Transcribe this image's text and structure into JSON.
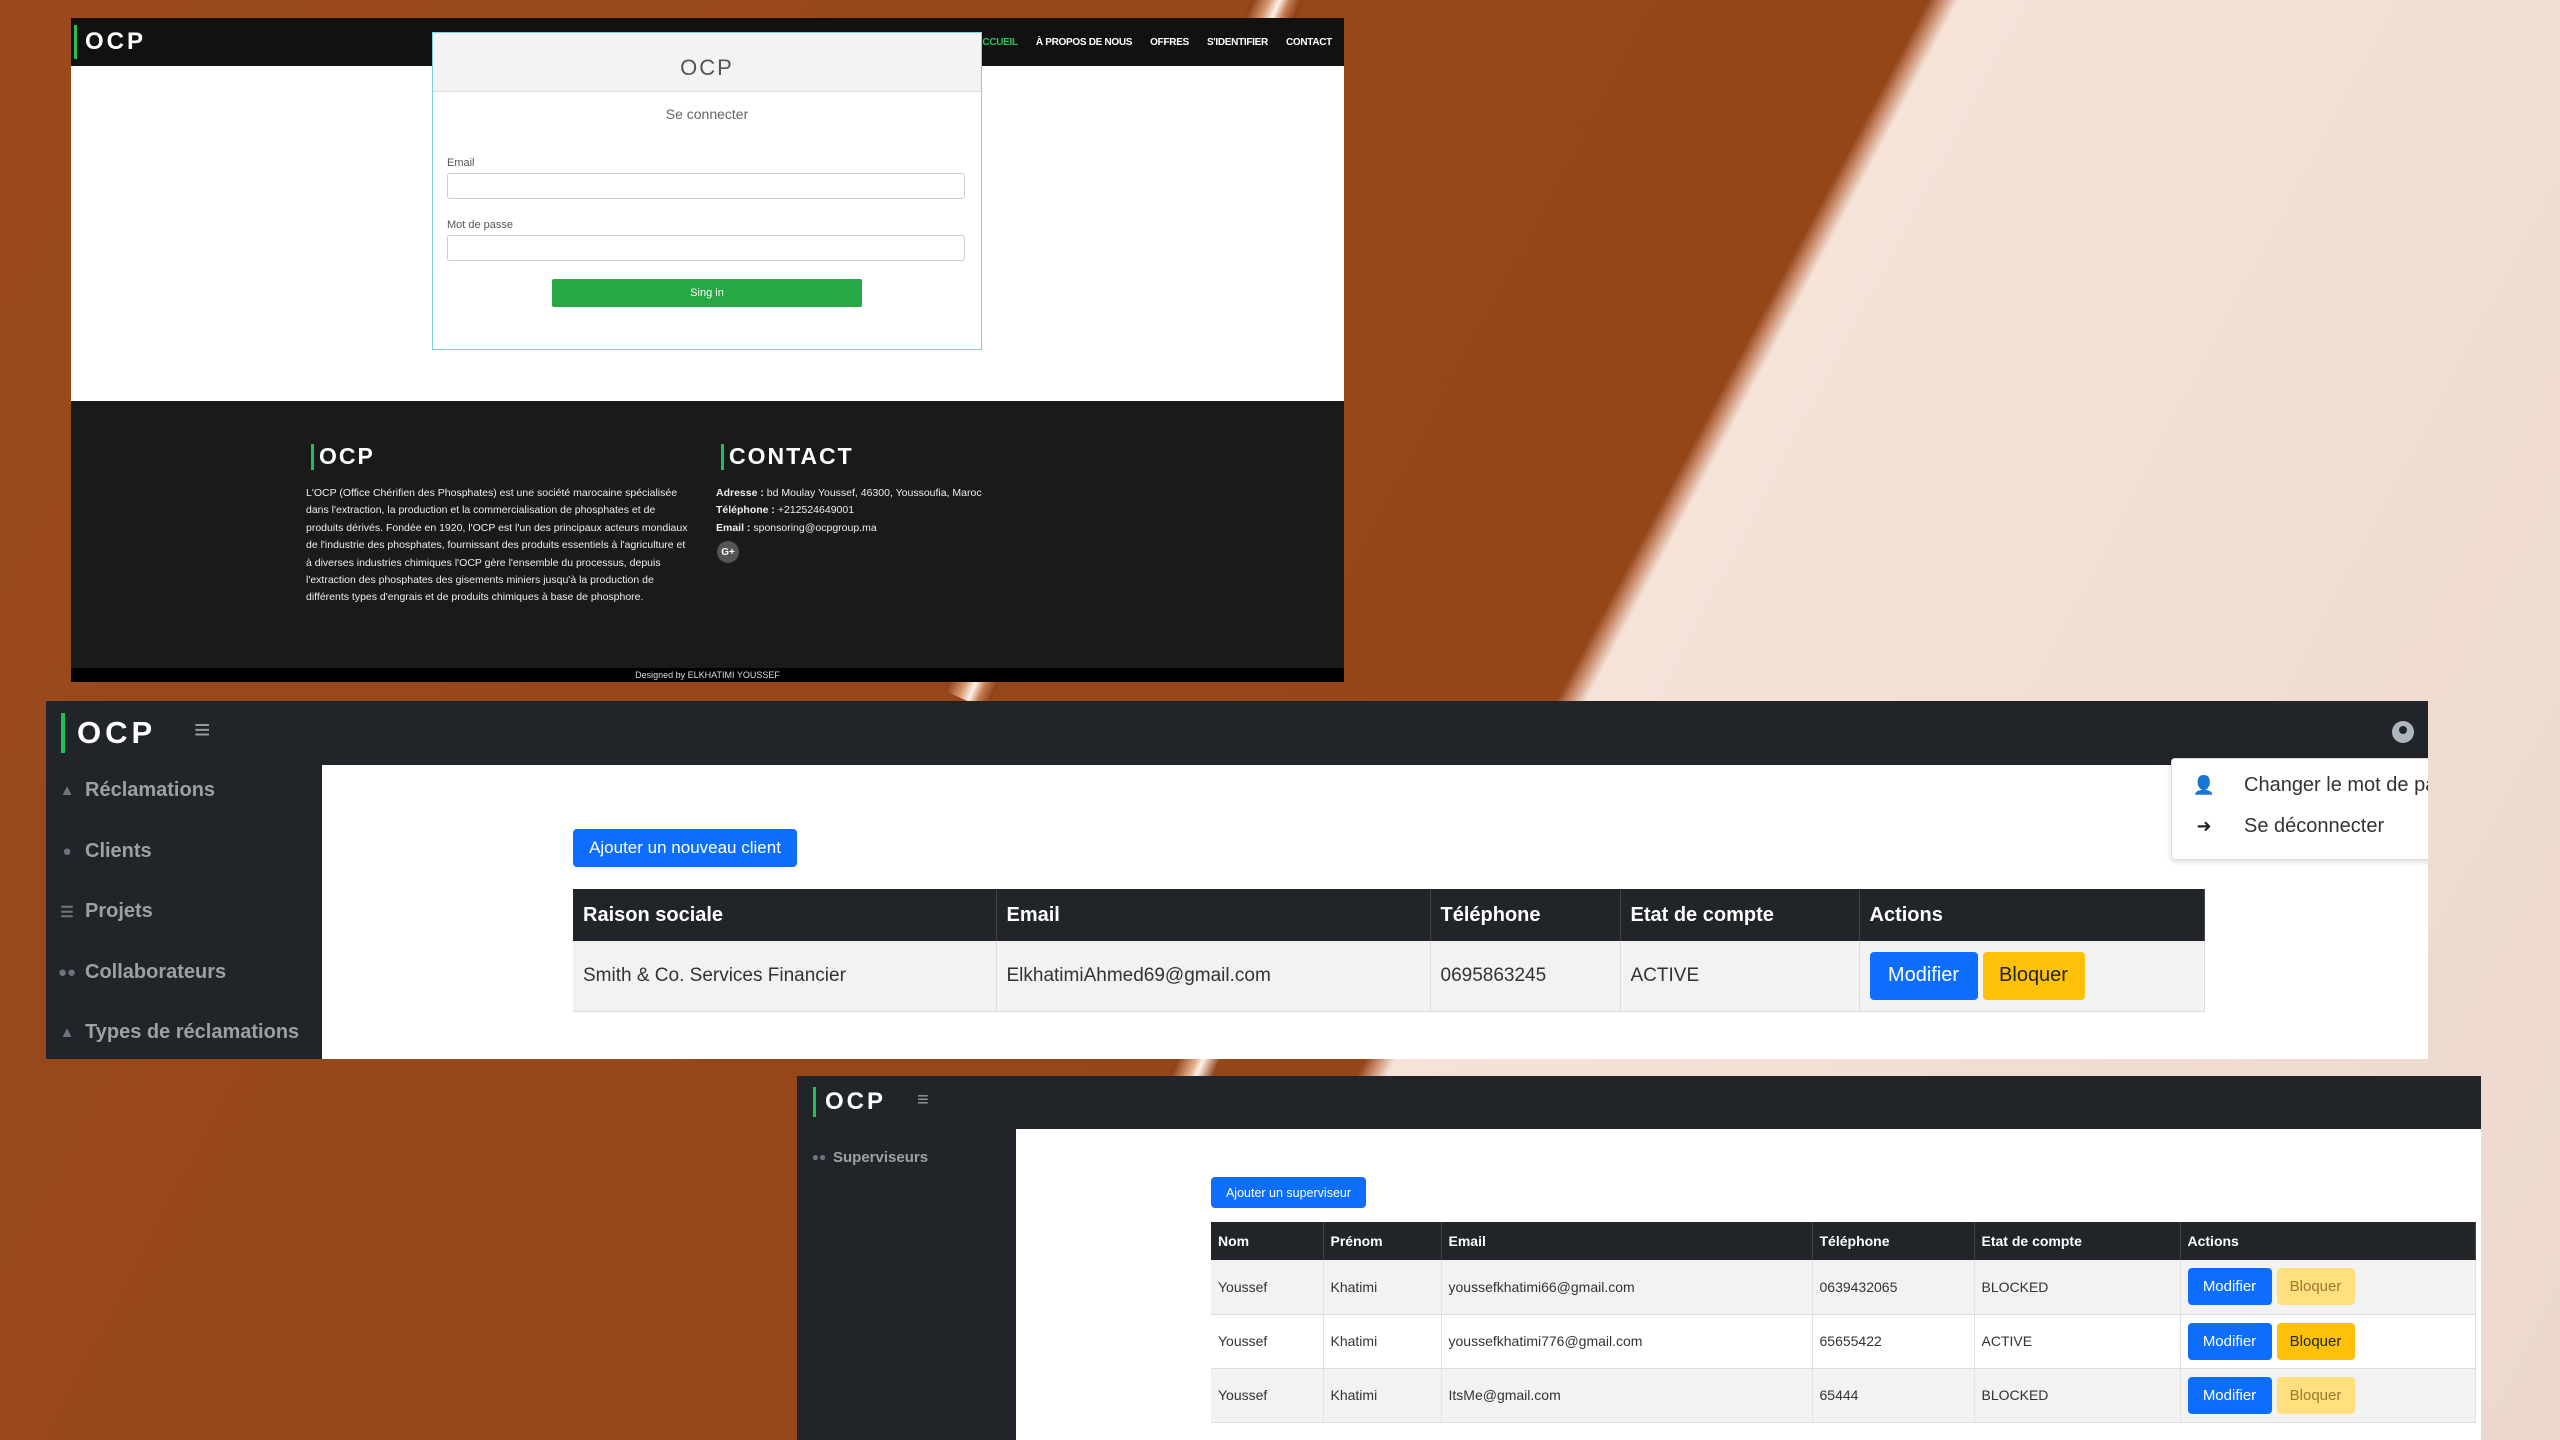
{
  "login_page": {
    "brand": "OCP",
    "nav": [
      "ACCUEIL",
      "À PROPOS DE NOUS",
      "OFFRES",
      "S'IDENTIFIER",
      "CONTACT"
    ],
    "card_ghost": "OCP",
    "card_title": "Se connecter",
    "email_label": "Email",
    "password_label": "Mot de passe",
    "submit": "Sing in",
    "footer": {
      "about_title": "OCP",
      "about_text": "L'OCP (Office Chérifien des Phosphates) est une société marocaine spécialisée dans l'extraction, la production et la commercialisation de phosphates et de produits dérivés. Fondée en 1920, l'OCP est l'un des principaux acteurs mondiaux de l'industrie des phosphates, fournissant des produits essentiels à l'agriculture et à diverses industries chimiques l'OCP gère l'ensemble du processus, depuis l'extraction des phosphates des gisements miniers jusqu'à la production de différents types d'engrais et de produits chimiques à base de phosphore.",
      "contact_title": "CONTACT",
      "address_label": "Adresse :",
      "address": "bd Moulay Youssef, 46300, Youssoufia, Maroc",
      "phone_label": "Téléphone :",
      "phone": "+212524649001",
      "email_label": "Email :",
      "email": "sponsoring@ocpgroup.ma",
      "social": "G+",
      "designed_by": "Designed by ELKHATIMI YOUSSEF"
    }
  },
  "clients_page": {
    "brand": "OCP",
    "menu_icon": "≡",
    "sidebar": [
      {
        "label": "Réclamations",
        "icon": "warning-icon"
      },
      {
        "label": "Clients",
        "icon": "user-icon"
      },
      {
        "label": "Projets",
        "icon": "list-icon"
      },
      {
        "label": "Collaborateurs",
        "icon": "users-icon"
      },
      {
        "label": "Types de réclamations",
        "icon": "warning-icon"
      }
    ],
    "add_button": "Ajouter un nouveau client",
    "columns": [
      "Raison sociale",
      "Email",
      "Téléphone",
      "Etat de compte",
      "Actions"
    ],
    "rows": [
      {
        "raison": "Smith & Co. Services Financier",
        "email": "ElkhatimiAhmed69@gmail.com",
        "tel": "0695863245",
        "etat": "ACTIVE",
        "modifier": "Modifier",
        "bloquer": "Bloquer"
      }
    ],
    "user_menu": [
      "Changer le mot de passe",
      "Se déconnecter"
    ]
  },
  "superviseurs_page": {
    "brand": "OCP",
    "menu_icon": "≡",
    "sidebar_item": "Superviseurs",
    "add_button": "Ajouter un superviseur",
    "columns": [
      "Nom",
      "Prénom",
      "Email",
      "Téléphone",
      "Etat de compte",
      "Actions"
    ],
    "rows": [
      {
        "nom": "Youssef",
        "prenom": "Khatimi",
        "email": "youssefkhatimi66@gmail.com",
        "tel": "0639432065",
        "etat": "BLOCKED",
        "modifier": "Modifier",
        "bloquer": "Bloquer"
      },
      {
        "nom": "Youssef",
        "prenom": "Khatimi",
        "email": "youssefkhatimi776@gmail.com",
        "tel": "65655422",
        "etat": "ACTIVE",
        "modifier": "Modifier",
        "bloquer": "Bloquer"
      },
      {
        "nom": "Youssef",
        "prenom": "Khatimi",
        "email": "ItsMe@gmail.com",
        "tel": "65444",
        "etat": "BLOCKED",
        "modifier": "Modifier",
        "bloquer": "Bloquer"
      }
    ]
  },
  "colors": {
    "brand_accent": "#1fbf5a",
    "nav_dark": "#212529",
    "primary": "#0d6efd",
    "warning": "#ffc107",
    "success": "#28a745"
  }
}
